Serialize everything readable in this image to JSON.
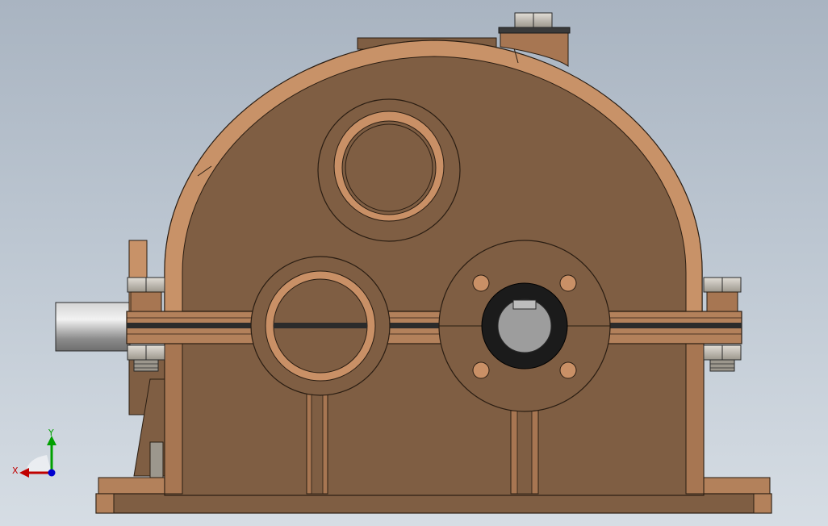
{
  "viewport": {
    "colors": {
      "background_top": "#a9b4c1",
      "background_bottom": "#d6dde4",
      "housing": "#7f5e43",
      "housing_light": "#c89268",
      "edge": "#2a1d12",
      "bolt": "#b9b5ac",
      "shaft": "#a9a9a9",
      "bore_dark": "#1b1b1b",
      "bore_inner": "#9d9d9d"
    }
  },
  "triad": {
    "x_label": "X",
    "y_label": "Y",
    "colors": {
      "x": "#c00000",
      "y": "#00a000",
      "z": "#0000d0"
    }
  }
}
